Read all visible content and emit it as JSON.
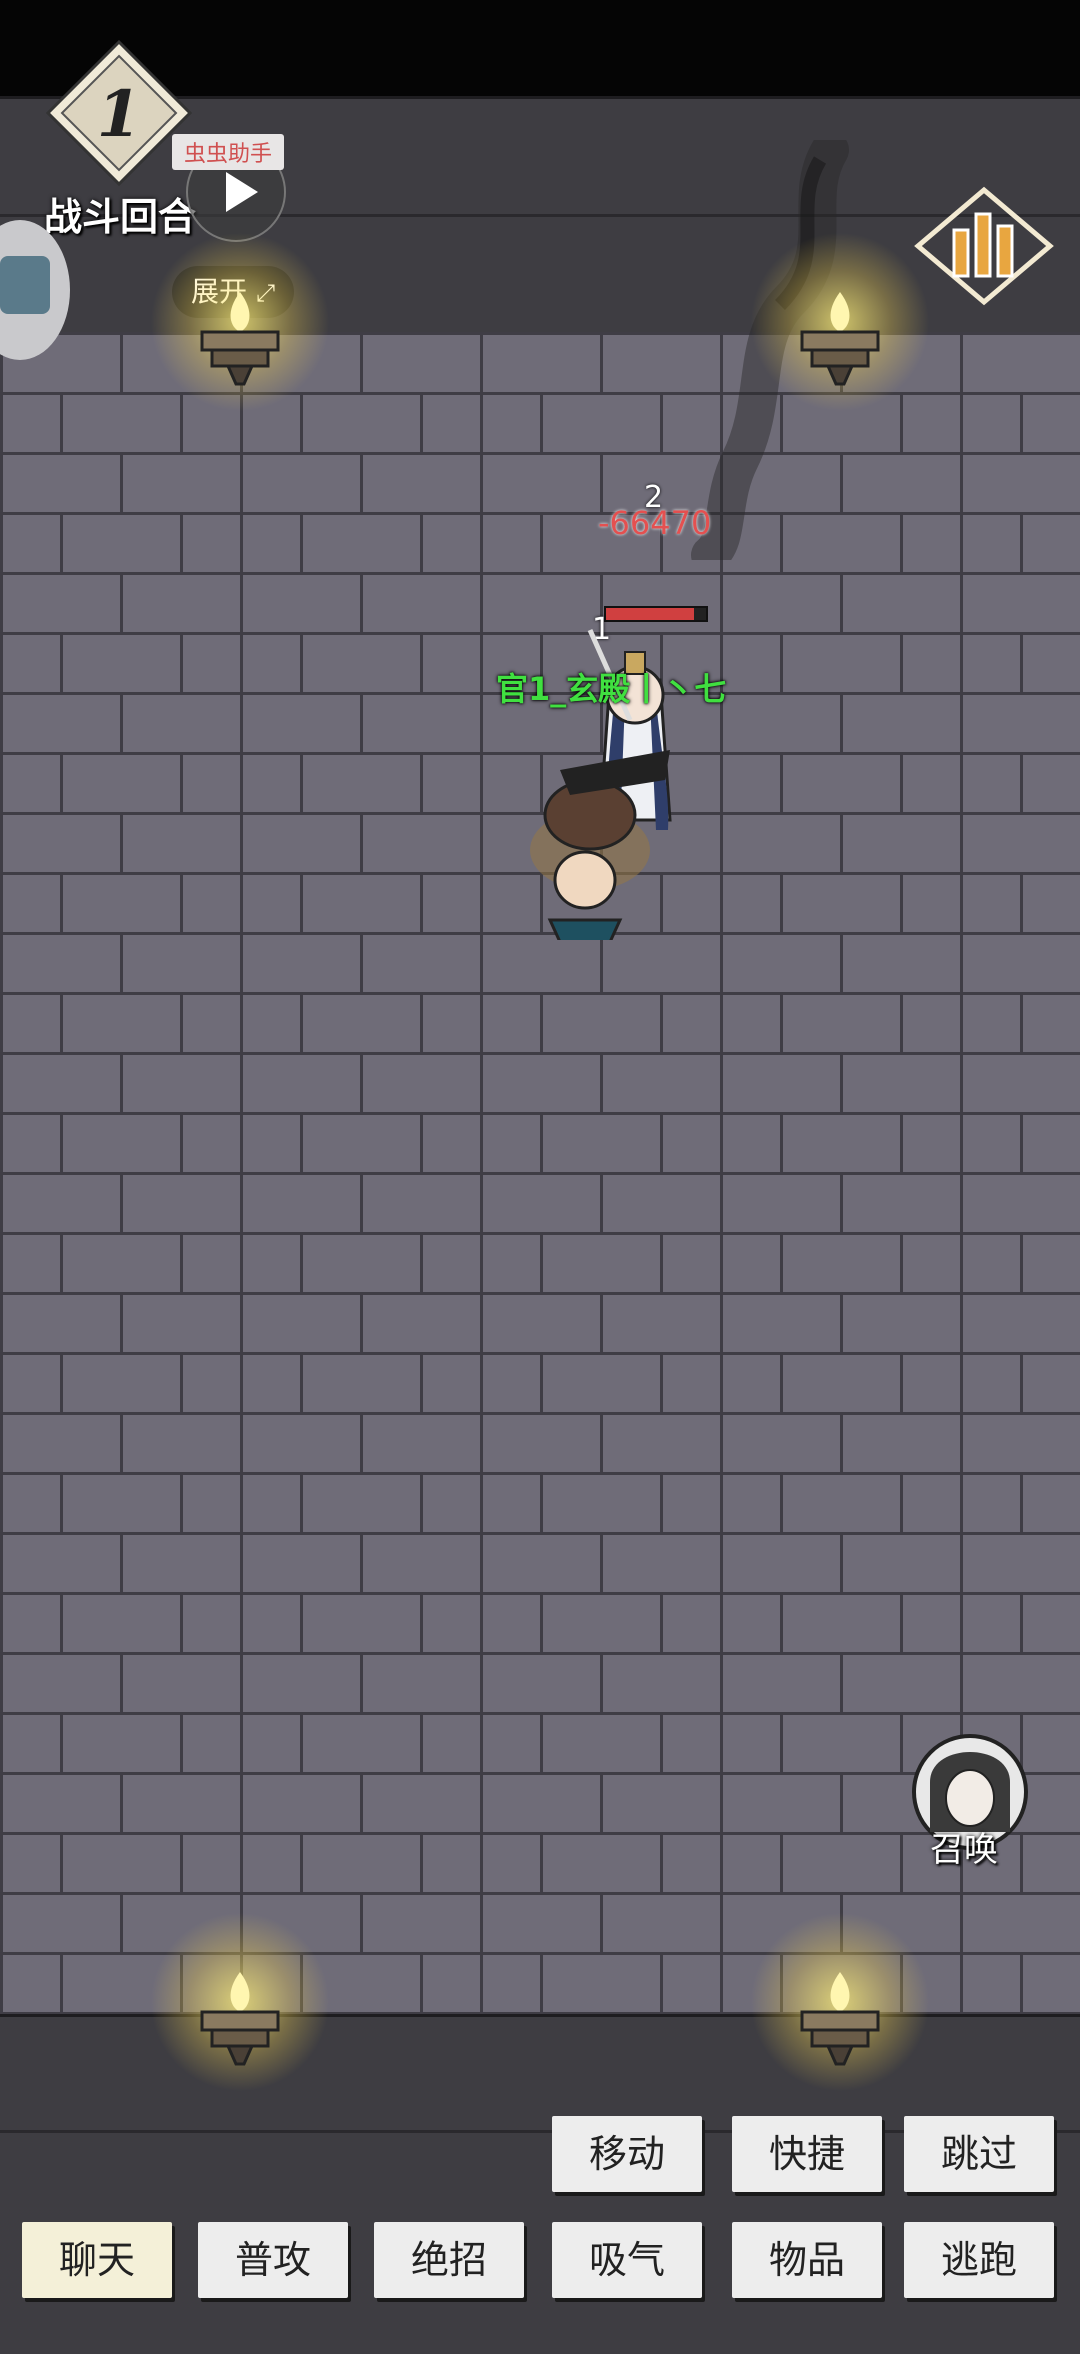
{
  "hud": {
    "round_number": "1",
    "round_label": "战斗回合",
    "helper_tag": "虫虫助手",
    "expand_label": "展开"
  },
  "battle": {
    "hit_count": "2",
    "damage_value": "-66470",
    "unit_index": "1",
    "unit_name": "官1_玄殿丨丶七",
    "enemy_hp_fraction": 0.88
  },
  "summon": {
    "label": "召唤"
  },
  "actions": {
    "row1": [
      "移动",
      "快捷",
      "跳过"
    ],
    "row2": [
      "聊天",
      "普攻",
      "绝招",
      "吸气",
      "物品",
      "逃跑"
    ]
  },
  "colors": {
    "damage": "#e45050",
    "name": "#40e040",
    "wall": "#3e3d42",
    "floor": "#6f6c78"
  }
}
